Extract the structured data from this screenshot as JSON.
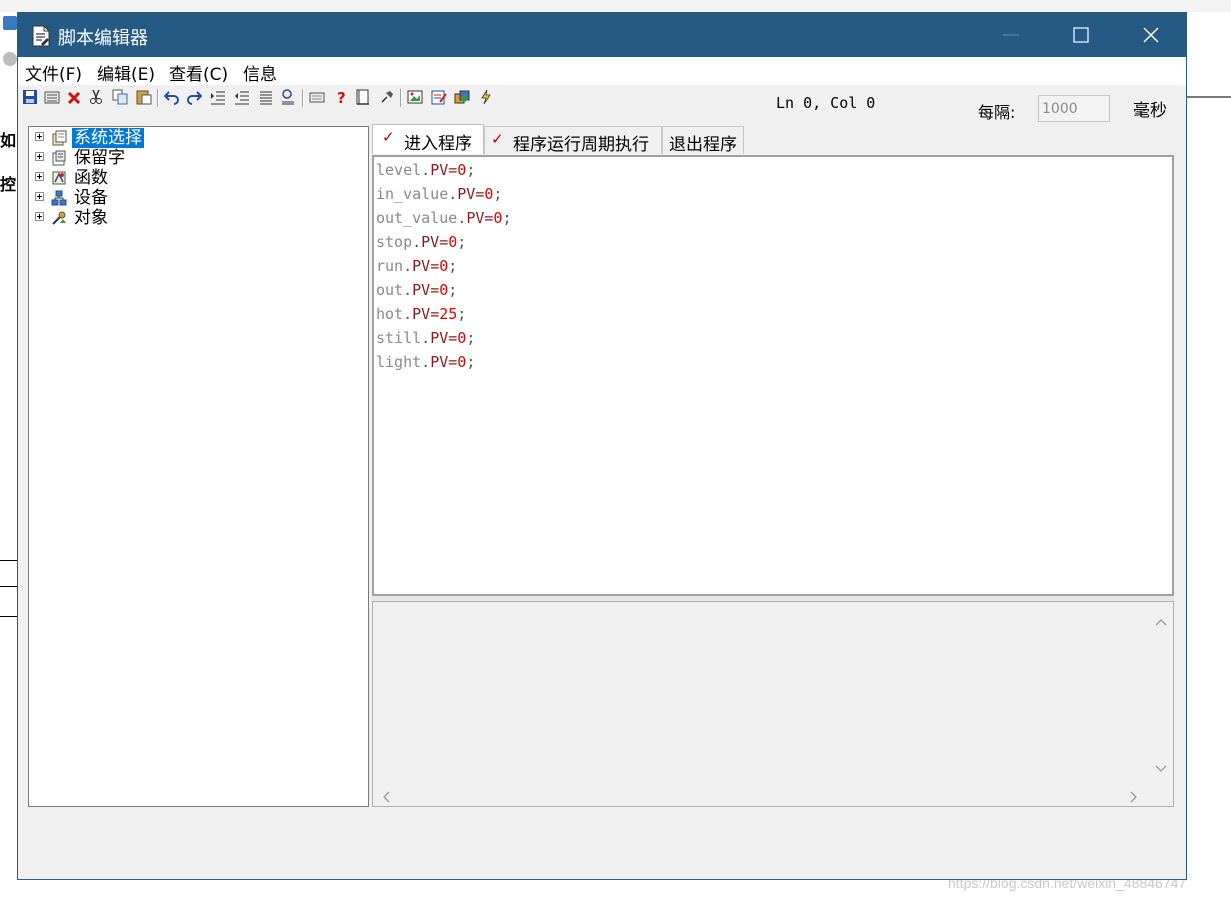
{
  "window": {
    "title": "脚本编辑器",
    "accent": "#245a84"
  },
  "menu": {
    "items": [
      "文件(F)",
      "编辑(E)",
      "查看(C)",
      "信息"
    ]
  },
  "toolbar": {
    "icons": [
      "save-icon",
      "save-all-icon",
      "delete-icon",
      "cut-icon",
      "copy-icon",
      "paste-icon",
      "undo-icon",
      "redo-icon",
      "indent-icon",
      "outdent-icon",
      "list-icon",
      "comment-icon",
      "keyboard-icon",
      "help-icon",
      "book-icon",
      "pin-icon",
      "image-icon",
      "edit-icon",
      "gallery-icon",
      "lightning-icon"
    ],
    "cursor_pos": "Ln 0, Col 0",
    "interval_label": "每隔:",
    "interval_value": "1000",
    "interval_unit": "毫秒"
  },
  "tree": {
    "items": [
      {
        "label": "系统选择",
        "icon": "system-icon",
        "selected": true
      },
      {
        "label": "保留字",
        "icon": "reserved-words-icon",
        "selected": false
      },
      {
        "label": "函数",
        "icon": "function-icon",
        "selected": false
      },
      {
        "label": "设备",
        "icon": "device-icon",
        "selected": false
      },
      {
        "label": "对象",
        "icon": "object-icon",
        "selected": false
      }
    ]
  },
  "tabs": [
    {
      "label": "进入程序",
      "checked": true,
      "active": true
    },
    {
      "label": "程序运行周期执行",
      "checked": true,
      "active": false
    },
    {
      "label": "退出程序",
      "checked": false,
      "active": false
    }
  ],
  "editor": {
    "lines": [
      {
        "name": "level",
        "prop": "PV",
        "value": "0"
      },
      {
        "name": "in_value",
        "prop": "PV",
        "value": "0"
      },
      {
        "name": "out_value",
        "prop": "PV",
        "value": "0"
      },
      {
        "name": "stop",
        "prop": "PV",
        "value": "0"
      },
      {
        "name": "run",
        "prop": "PV",
        "value": "0"
      },
      {
        "name": "out",
        "prop": "PV",
        "value": "0"
      },
      {
        "name": "hot",
        "prop": "PV",
        "value": "25"
      },
      {
        "name": "still",
        "prop": "PV",
        "value": "0"
      },
      {
        "name": "light",
        "prop": "PV",
        "value": "0"
      }
    ]
  },
  "background": {
    "chars": [
      "如",
      "控"
    ],
    "watermark": "https://blog.csdn.net/weixin_48846747"
  }
}
